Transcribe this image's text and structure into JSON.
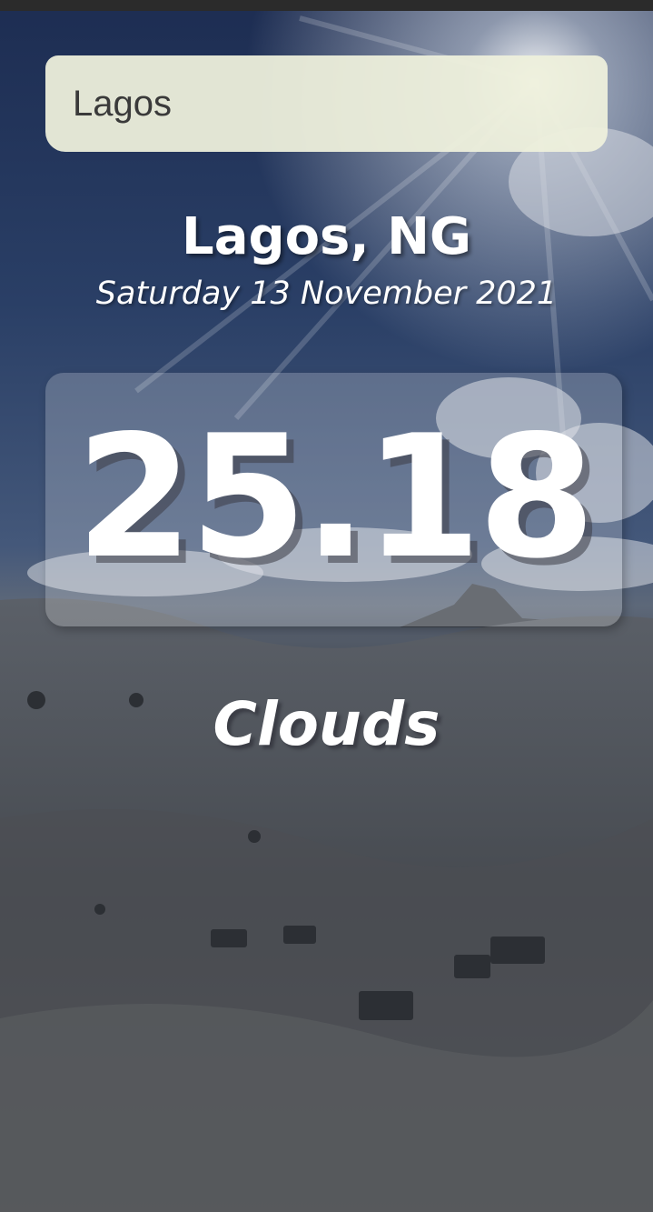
{
  "search": {
    "value": "Lagos",
    "placeholder": ""
  },
  "location": {
    "city_country": "Lagos, NG",
    "date": "Saturday 13 November 2021"
  },
  "weather": {
    "temperature": "25.18",
    "condition": "Clouds"
  },
  "colors": {
    "search_background": "#EEF0DC",
    "text": "#FFFFFF",
    "sky": "#1D2D52"
  }
}
